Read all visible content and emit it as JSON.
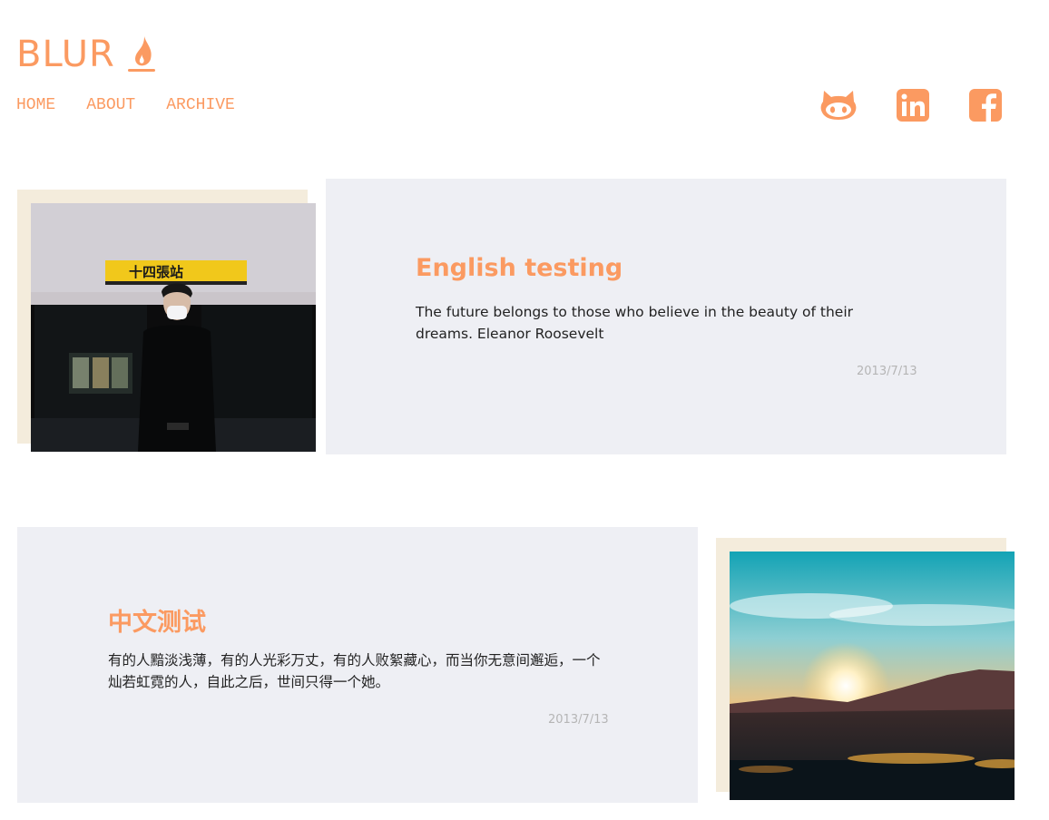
{
  "brand": {
    "name": "BLUR",
    "accent": "#fb9a61"
  },
  "nav": [
    "HOME",
    "ABOUT",
    "ARCHIVE"
  ],
  "social": [
    "github-icon",
    "linkedin-icon",
    "facebook-icon"
  ],
  "posts": [
    {
      "title": "English testing",
      "body": "The future belongs to those who believe in the beauty of their dreams. Eleanor Roosevelt",
      "date": "2013/7/13"
    },
    {
      "title": "中文测试",
      "body": "有的人黯淡浅薄，有的人光彩万丈，有的人败絮藏心，而当你无意间邂逅，一个灿若虹霓的人，自此之后，世间只得一个她。",
      "date": "2013/7/13"
    }
  ],
  "photos": {
    "first": {
      "sign_text": "十四張站"
    }
  },
  "colors": {
    "card": "#eeeff4",
    "frame": "#f4ecdc",
    "date": "#b5b5b5"
  }
}
